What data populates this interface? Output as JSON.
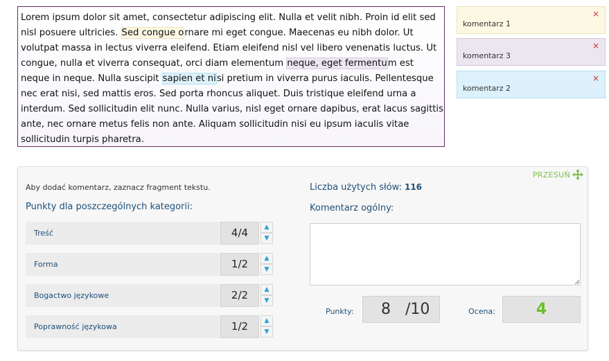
{
  "text": {
    "seg1": "Lorem ipsum dolor sit amet, consectetur adipiscing elit. Nulla et velit nibh. Proin id elit sed nisl posuere ultricies. ",
    "hl1": "Sed congue o",
    "seg2": "rnare mi eget congue. Maecenas eu nibh dolor. Ut volutpat massa in lectus viverra eleifend. Etiam eleifend nisl vel libero venenatis luctus. Ut congue, nulla et viverra consequat, orci diam elementum ",
    "hl3": "neque, eget fermentu",
    "seg3": "m est neque in neque. Nulla suscipit ",
    "hl2": "sapien et ni",
    "seg4": "si pretium in viverra purus iaculis. Pellentesque nec erat nisi, sed mattis eros. Sed porta rhoncus aliquet. Duis tristique eleifend urna a interdum. Sed sollicitudin elit nunc. Nulla varius, nisl eget ornare dapibus, erat lacus sagittis ante, nec ornare metus felis non ante. Aliquam sollicitudin nisi eu ipsum iaculis vitae sollicitudin turpis pharetra."
  },
  "comments": [
    {
      "label": "komentarz 1",
      "close": "×"
    },
    {
      "label": "komentarz 3",
      "close": "×"
    },
    {
      "label": "komentarz 2",
      "close": "×"
    }
  ],
  "panel": {
    "move_label": "PRZESUŃ",
    "instruction": "Aby dodać komentarz, zaznacz fragment tekstu.",
    "categories_title": "Punkty dla poszczególnych kategorii:",
    "categories": [
      {
        "name": "Treść",
        "score": "4/4"
      },
      {
        "name": "Forma",
        "score": "1/2"
      },
      {
        "name": "Bogactwo językowe",
        "score": "2/2"
      },
      {
        "name": "Poprawność językowa",
        "score": "1/2"
      }
    ],
    "spin_up": "▲",
    "spin_down": "▼",
    "word_count_label": "Liczba użytych słów:",
    "word_count_value": "116",
    "general_comment_label": "Komentarz ogólny:",
    "general_comment_value": "",
    "points_label": "Punkty:",
    "points_value": "8",
    "points_max": "/10",
    "grade_label": "Ocena:",
    "grade_value": "4"
  },
  "colors": {
    "accent_text": "#1e4f7a",
    "move_green": "#7fbf4a",
    "grade_green": "#6cc02e",
    "spin_blue": "#2a9fd6",
    "text_border": "#6a2a6a"
  },
  "icons": {
    "move": "move-arrows-icon",
    "close": "close-icon",
    "spin_up": "arrow-up-icon",
    "spin_down": "arrow-down-icon"
  }
}
